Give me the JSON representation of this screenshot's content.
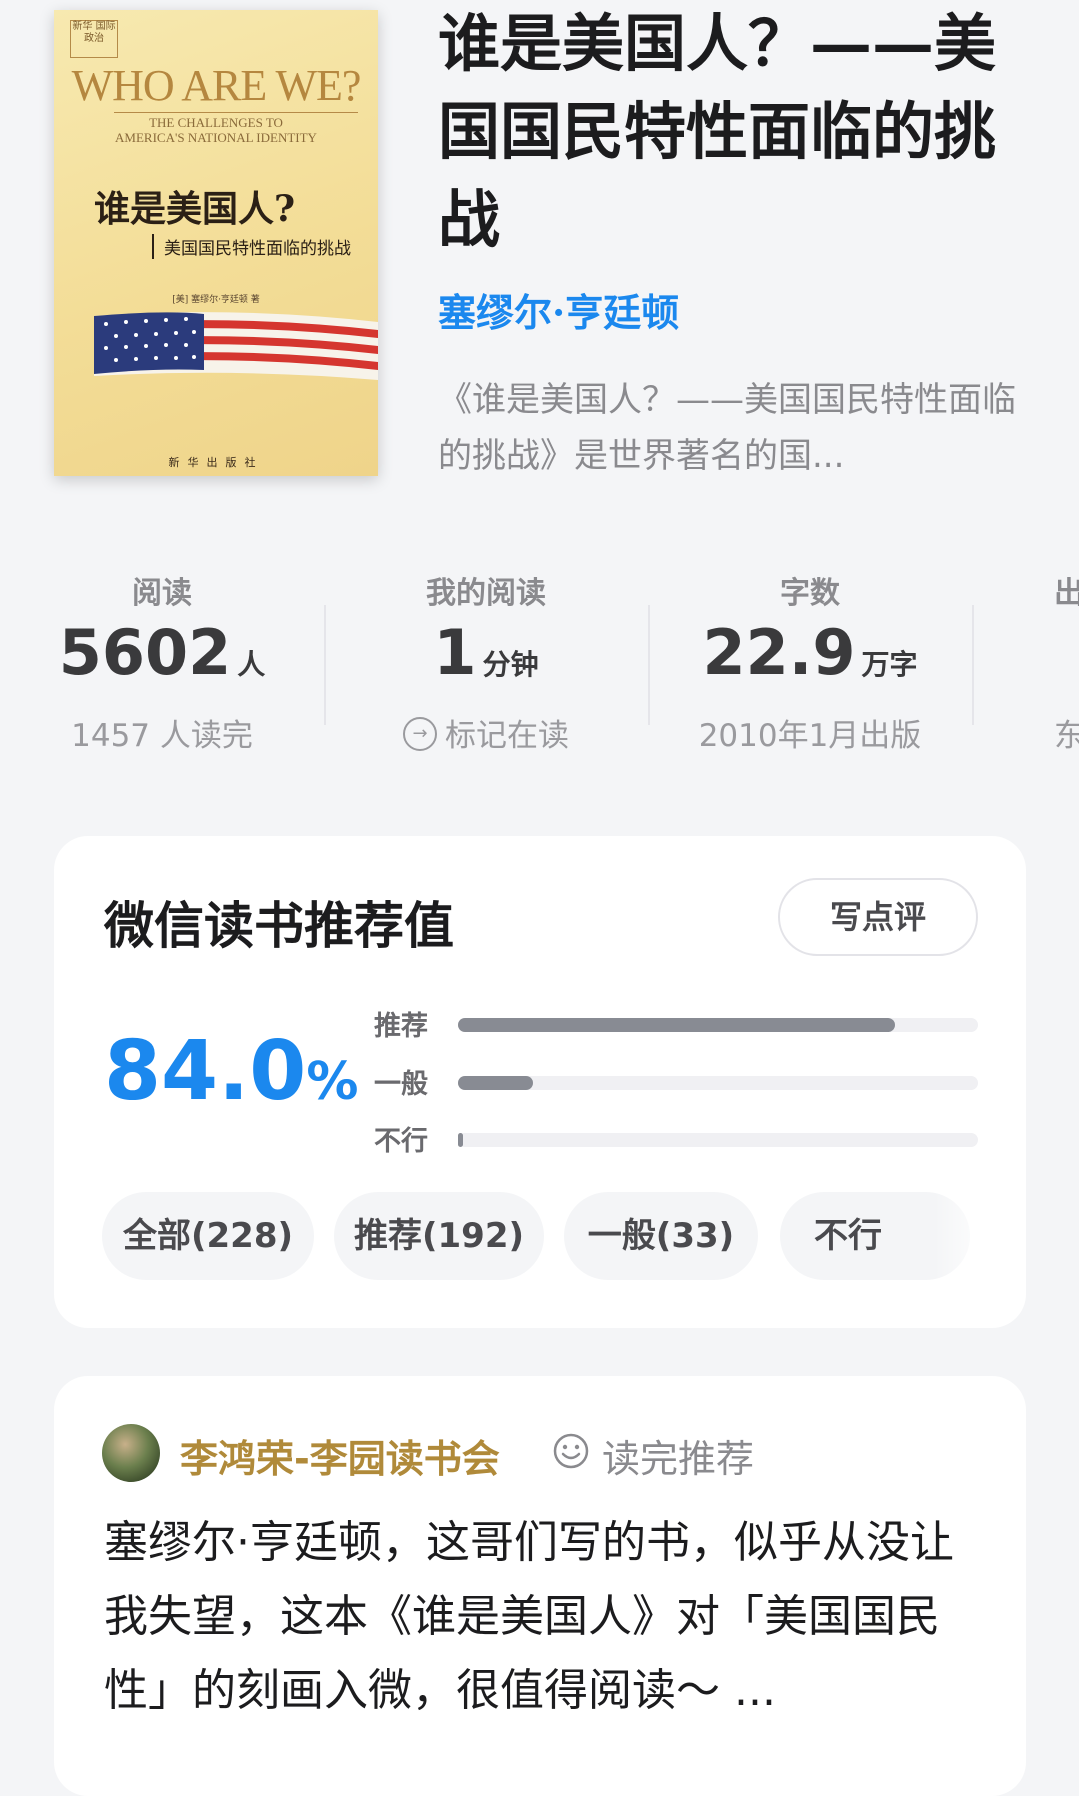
{
  "book": {
    "title": "谁是美国人？——美国国民特性面临的挑战",
    "author": "塞缪尔·亨廷顿",
    "intro": "《谁是美国人？——美国国民特性面临的挑战》是世界著名的国...",
    "cover": {
      "badge": "新华 国际政治",
      "title_en": "WHO ARE WE?",
      "subtitle_en_1": "THE CHALLENGES TO",
      "subtitle_en_2": "AMERICA'S NATIONAL IDENTITY",
      "title_zh": "谁是美国人?",
      "subtitle_zh": "美国国民特性面临的挑战",
      "author_line": "[美] 塞缪尔·亨廷顿 著",
      "publisher": "新华出版社"
    }
  },
  "stats": [
    {
      "label": "阅读",
      "value": "5602",
      "unit": "人",
      "note": "1457 人读完"
    },
    {
      "label": "我的阅读",
      "value": "1",
      "unit": "分钟",
      "note": "标记在读",
      "note_icon": "arrow-circle-icon"
    },
    {
      "label": "字数",
      "value": "22.9",
      "unit": "万字",
      "note": "2010年1月出版"
    },
    {
      "label": "出",
      "value": "",
      "unit": "",
      "note": "东"
    }
  ],
  "recommend": {
    "title": "微信读书推荐值",
    "review_button": "写点评",
    "percent": "84.0",
    "percent_sign": "%",
    "bars": [
      {
        "label": "推荐",
        "fraction": 0.84
      },
      {
        "label": "一般",
        "fraction": 0.145
      },
      {
        "label": "不行",
        "fraction": 0.01
      }
    ],
    "filters": [
      "全部(228)",
      "推荐(192)",
      "一般(33)",
      "不行"
    ]
  },
  "comment": {
    "user": "李鸿荣-李园读书会",
    "tag": "读完推荐",
    "text": "塞缪尔·亨廷顿，这哥们写的书，似乎从没让我失望，这本《谁是美国人》对「美国国民性」的刻画入微，很值得阅读～ ..."
  },
  "colors": {
    "accent": "#1b88ee",
    "username": "#b08a3a",
    "bar": "#888b93"
  }
}
